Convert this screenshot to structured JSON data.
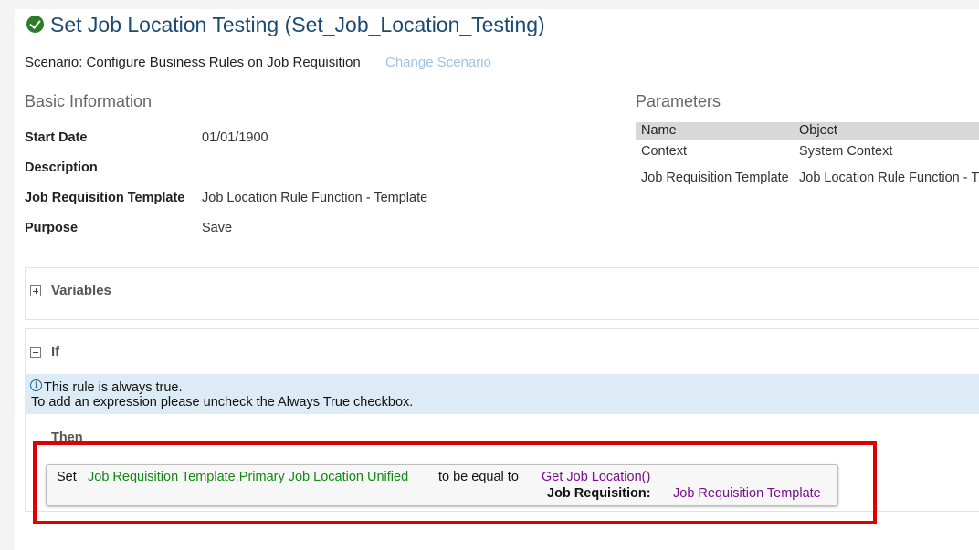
{
  "header": {
    "title": "Set Job Location Testing (Set_Job_Location_Testing)",
    "status_icon": "check-circle-icon",
    "scenario_label": "Scenario: Configure Business Rules on Job Requisition",
    "change_scenario": "Change Scenario"
  },
  "basic_info": {
    "heading": "Basic Information",
    "fields": [
      {
        "label": "Start Date",
        "value": "01/01/1900"
      },
      {
        "label": "Description",
        "value": ""
      },
      {
        "label": "Job Requisition Template",
        "value": "Job Location Rule Function - Template"
      },
      {
        "label": "Purpose",
        "value": "Save"
      }
    ]
  },
  "parameters": {
    "heading": "Parameters",
    "columns": [
      "Name",
      "Object"
    ],
    "rows": [
      {
        "name": "Context",
        "object": "System Context"
      },
      {
        "name": "Job Requisition Template",
        "object": "Job Location Rule Function - T..."
      }
    ]
  },
  "variables": {
    "title": "Variables",
    "icon": "expand-plus-icon"
  },
  "if_section": {
    "title": "If",
    "icon": "collapse-minus-icon",
    "info_icon": "info-icon",
    "info_line1": "This rule is always true.",
    "info_line2": "To add an expression please uncheck the Always True checkbox."
  },
  "then_section": {
    "title": "Then",
    "statement": {
      "keyword": "Set",
      "target": "Job Requisition Template.Primary Job Location Unified",
      "operator": "to be equal to",
      "function": "Get Job Location()",
      "param_label": "Job Requisition:",
      "param_value": "Job Requisition Template"
    }
  },
  "colors": {
    "title": "#1c4a73",
    "link": "#9ec3e6",
    "highlight_border": "#e00000",
    "field_green": "#108a10",
    "function_purple": "#7a0f8f",
    "info_band": "#dcebf5"
  }
}
